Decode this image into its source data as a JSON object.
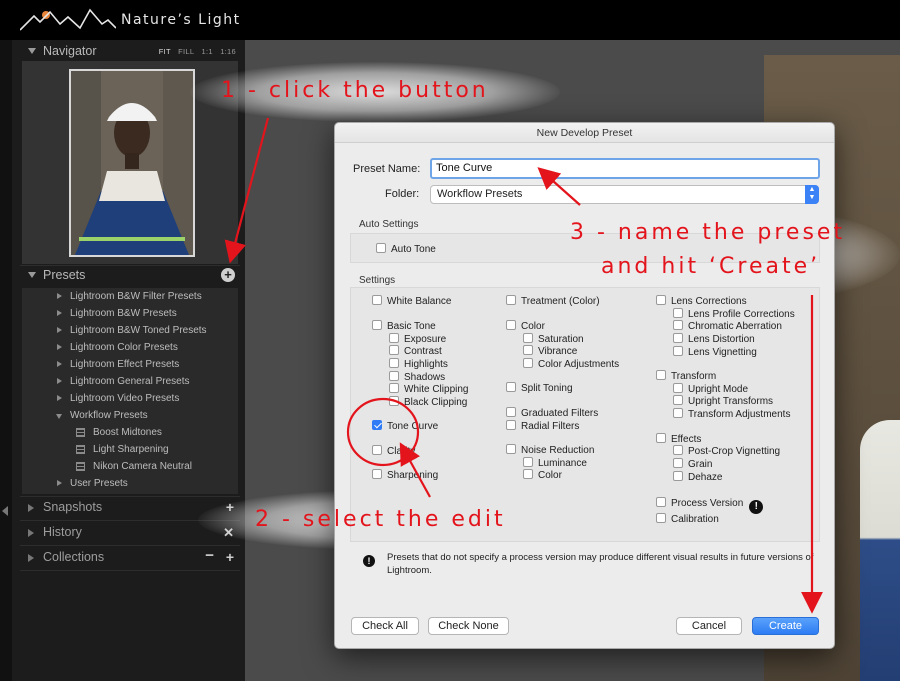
{
  "brand": {
    "name": "Nature’s Light"
  },
  "panels": {
    "navigator": {
      "title": "Navigator",
      "zoom_options": [
        "FIT",
        "FILL",
        "1:1",
        "1:16"
      ],
      "active_zoom": "FIT"
    },
    "presets": {
      "title": "Presets",
      "items": [
        {
          "label": "Lightroom B&W Filter Presets",
          "type": "folder",
          "open": false
        },
        {
          "label": "Lightroom B&W Presets",
          "type": "folder",
          "open": false
        },
        {
          "label": "Lightroom B&W Toned Presets",
          "type": "folder",
          "open": false
        },
        {
          "label": "Lightroom Color Presets",
          "type": "folder",
          "open": false
        },
        {
          "label": "Lightroom Effect Presets",
          "type": "folder",
          "open": false
        },
        {
          "label": "Lightroom General Presets",
          "type": "folder",
          "open": false
        },
        {
          "label": "Lightroom Video Presets",
          "type": "folder",
          "open": false
        },
        {
          "label": "Workflow Presets",
          "type": "folder",
          "open": true
        },
        {
          "label": "Boost Midtones",
          "type": "preset"
        },
        {
          "label": "Light Sharpening",
          "type": "preset"
        },
        {
          "label": "Nikon Camera Neutral",
          "type": "preset"
        },
        {
          "label": "User Presets",
          "type": "folder",
          "open": false
        }
      ]
    },
    "snapshots": {
      "title": "Snapshots"
    },
    "history": {
      "title": "History"
    },
    "collections": {
      "title": "Collections"
    }
  },
  "dialog": {
    "title": "New Develop Preset",
    "preset_name_label": "Preset Name:",
    "preset_name_value": "Tone Curve",
    "folder_label": "Folder:",
    "folder_value": "Workflow Presets",
    "auto_settings_label": "Auto Settings",
    "auto_tone": "Auto Tone",
    "settings_label": "Settings",
    "col1": {
      "white_balance": "White Balance",
      "basic_tone": "Basic Tone",
      "exposure": "Exposure",
      "contrast": "Contrast",
      "highlights": "Highlights",
      "shadows": "Shadows",
      "white_clipping": "White Clipping",
      "black_clipping": "Black Clipping",
      "tone_curve": "Tone Curve",
      "clarity": "Clarity",
      "sharpening": "Sharpening"
    },
    "col2": {
      "treatment": "Treatment (Color)",
      "color": "Color",
      "saturation": "Saturation",
      "vibrance": "Vibrance",
      "color_adjustments": "Color Adjustments",
      "split_toning": "Split Toning",
      "graduated_filters": "Graduated Filters",
      "radial_filters": "Radial Filters",
      "noise_reduction": "Noise Reduction",
      "luminance": "Luminance",
      "nr_color": "Color"
    },
    "col3": {
      "lens_corrections": "Lens Corrections",
      "lens_profile_corrections": "Lens Profile Corrections",
      "chromatic_aberration": "Chromatic Aberration",
      "lens_distortion": "Lens Distortion",
      "lens_vignetting": "Lens Vignetting",
      "transform": "Transform",
      "upright_mode": "Upright Mode",
      "upright_transforms": "Upright Transforms",
      "transform_adjustments": "Transform Adjustments",
      "effects": "Effects",
      "post_crop_vignetting": "Post-Crop Vignetting",
      "grain": "Grain",
      "dehaze": "Dehaze",
      "process_version": "Process Version",
      "calibration": "Calibration"
    },
    "note": "Presets that do not specify a process version may produce different visual results in future versions of Lightroom.",
    "buttons": {
      "check_all": "Check All",
      "check_none": "Check None",
      "cancel": "Cancel",
      "create": "Create"
    }
  },
  "annotations": {
    "step1": "1 - click the button",
    "step2": "2 - select the edit",
    "step3_line1": "3 - name the preset",
    "step3_line2": "and hit ‘Create’"
  },
  "colors": {
    "annotation_red": "#e3141c",
    "accent_blue": "#2f7cf6",
    "panel_bg": "#1c1c1c"
  }
}
